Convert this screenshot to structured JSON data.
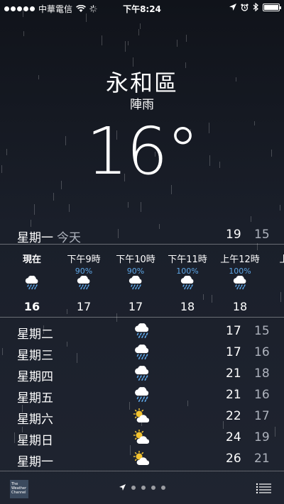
{
  "status_bar": {
    "carrier": "中華電信",
    "time": "下午8:24",
    "icons": [
      "signal-dots-icon",
      "wifi-icon",
      "activity-spinner-icon",
      "location-arrow-icon",
      "alarm-icon",
      "bluetooth-icon",
      "battery-icon"
    ]
  },
  "location": {
    "city": "永和區",
    "condition": "陣雨",
    "temperature": "16°"
  },
  "today": {
    "day": "星期一",
    "label": "今天",
    "high": "19",
    "low": "15"
  },
  "hourly": [
    {
      "time": "現在",
      "precip": "",
      "icon": "rain-cloud-icon",
      "temp": "16"
    },
    {
      "time": "下午9時",
      "precip": "90%",
      "icon": "rain-cloud-icon",
      "temp": "17"
    },
    {
      "time": "下午10時",
      "precip": "90%",
      "icon": "rain-cloud-icon",
      "temp": "17"
    },
    {
      "time": "下午11時",
      "precip": "100%",
      "icon": "rain-cloud-icon",
      "temp": "18"
    },
    {
      "time": "上午12時",
      "precip": "100%",
      "icon": "rain-cloud-icon",
      "temp": "18"
    },
    {
      "time": "上",
      "precip": "",
      "icon": "rain-cloud-icon",
      "temp": ""
    }
  ],
  "daily": [
    {
      "day": "星期二",
      "icon": "rain-cloud-icon",
      "high": "17",
      "low": "15"
    },
    {
      "day": "星期三",
      "icon": "rain-cloud-icon",
      "high": "17",
      "low": "16"
    },
    {
      "day": "星期四",
      "icon": "rain-cloud-icon",
      "high": "21",
      "low": "18"
    },
    {
      "day": "星期五",
      "icon": "rain-cloud-icon",
      "high": "21",
      "low": "16"
    },
    {
      "day": "星期六",
      "icon": "partly-sunny-icon",
      "high": "22",
      "low": "17"
    },
    {
      "day": "星期日",
      "icon": "partly-sunny-icon",
      "high": "24",
      "low": "19"
    },
    {
      "day": "星期一",
      "icon": "partly-sunny-icon",
      "high": "26",
      "low": "21"
    }
  ],
  "bottom_bar": {
    "logo_text": "The Weather Channel",
    "pages": 5,
    "current_page": 1
  },
  "colors": {
    "precip": "#5ea6e6",
    "low_temp": "#aeb3bd"
  }
}
